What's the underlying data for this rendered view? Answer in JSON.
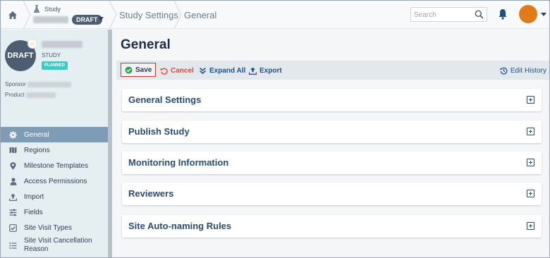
{
  "topbar": {
    "breadcrumb_study_label": "Study",
    "study_status": "DRAFT",
    "breadcrumb_settings": "Study Settings",
    "breadcrumb_general": "General",
    "search_placeholder": "Search",
    "avatar_color": "#e07b18"
  },
  "study_card": {
    "avatar_text": "DRAFT",
    "type_label": "STUDY",
    "status_badge": "PLANNED",
    "sponsor_label": "Sponsor",
    "product_label": "Product"
  },
  "sidebar": {
    "items": [
      {
        "label": "General",
        "icon": "gear-icon",
        "active": true
      },
      {
        "label": "Regions",
        "icon": "map-icon",
        "active": false
      },
      {
        "label": "Milestone Templates",
        "icon": "pin-icon",
        "active": false
      },
      {
        "label": "Access Permissions",
        "icon": "user-icon",
        "active": false
      },
      {
        "label": "Import",
        "icon": "upload-icon",
        "active": false
      },
      {
        "label": "Fields",
        "icon": "sliders-icon",
        "active": false
      },
      {
        "label": "Site Visit Types",
        "icon": "checkbox-icon",
        "active": false
      },
      {
        "label": "Site Visit Cancellation Reason",
        "icon": "list-icon",
        "active": false
      }
    ]
  },
  "main": {
    "title": "General",
    "toolbar": {
      "save": "Save",
      "cancel": "Cancel",
      "expand_all": "Expand All",
      "export": "Export",
      "edit_history": "Edit History"
    },
    "panels": [
      {
        "title": "General Settings"
      },
      {
        "title": "Publish Study"
      },
      {
        "title": "Monitoring Information"
      },
      {
        "title": "Reviewers"
      },
      {
        "title": "Site Auto-naming Rules"
      }
    ]
  },
  "colors": {
    "accent_blue": "#1d4e89",
    "sidebar_bg": "#e5eff2",
    "active_nav": "#7e9cb6",
    "cancel_red": "#d9493c",
    "planned_teal": "#3fc9c4",
    "save_green": "#2ea44f"
  }
}
